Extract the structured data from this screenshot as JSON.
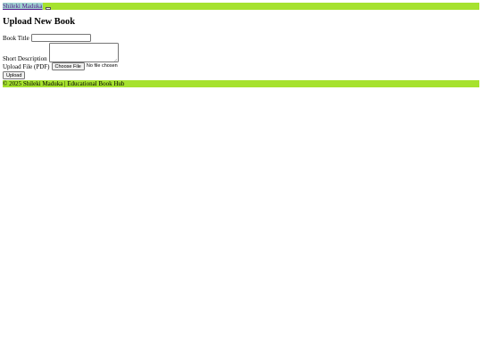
{
  "header": {
    "brand_link": "Shileki Maduka"
  },
  "page": {
    "title": "Upload New Book"
  },
  "form": {
    "book_title_label": "Book Title",
    "book_title_value": "",
    "short_description_label": "Short Description",
    "short_description_value": "",
    "file_label": "Upload File (PDF)",
    "choose_file_label": "Choose File",
    "file_status": "No file chosen",
    "submit_label": "Upload"
  },
  "footer": {
    "text": "© 2025 Shileki Maduka | Educational Book Hub"
  },
  "colors": {
    "bar_green": "#a6e22e",
    "brand_highlight": "#9fd3d0",
    "link_visited": "#551a8b"
  }
}
